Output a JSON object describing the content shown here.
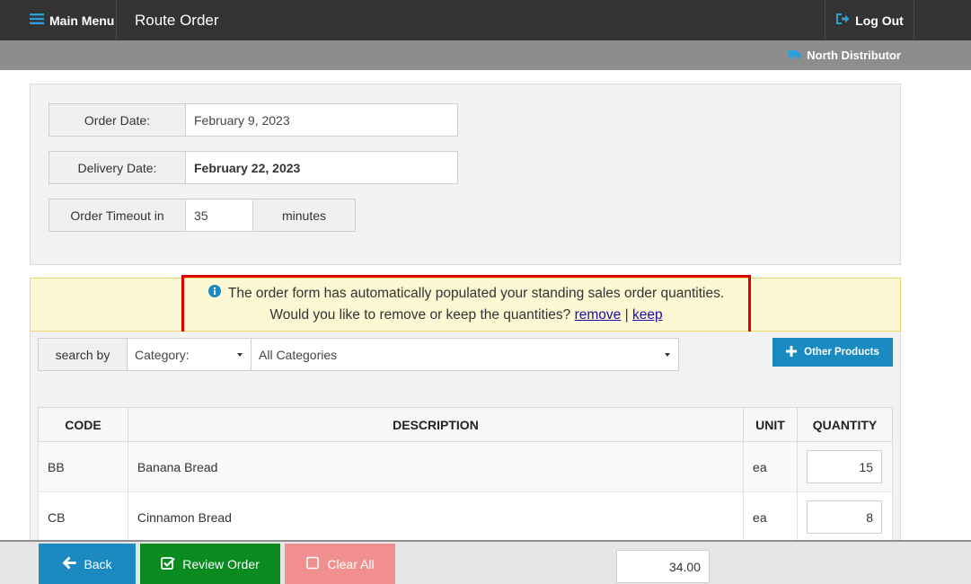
{
  "header": {
    "main_menu_label": "Main Menu",
    "title": "Route Order",
    "logout_label": "Log Out"
  },
  "subbar": {
    "distributor": "North Distributor"
  },
  "order_info": {
    "order_date_label": "Order Date:",
    "order_date_value": "February 9, 2023",
    "delivery_date_label": "Delivery Date:",
    "delivery_date_value": "February 22, 2023",
    "timeout_label": "Order Timeout in",
    "timeout_value": "35",
    "timeout_unit": "minutes"
  },
  "notice": {
    "line1": "The order form has automatically populated your standing sales order quantities.",
    "line2_prefix": "Would you like to remove or keep the quantities?",
    "remove_link": "remove",
    "separator": "|",
    "keep_link": "keep"
  },
  "search": {
    "label": "search by",
    "type_selected": "Category:",
    "category_selected": "All Categories",
    "other_products_label": "Other Products"
  },
  "table": {
    "headers": [
      "CODE",
      "DESCRIPTION",
      "UNIT",
      "QUANTITY"
    ],
    "rows": [
      {
        "code": "BB",
        "description": "Banana Bread",
        "unit": "ea",
        "quantity": "15"
      },
      {
        "code": "CB",
        "description": "Cinnamon Bread",
        "unit": "ea",
        "quantity": "8"
      }
    ]
  },
  "footer": {
    "back_label": "Back",
    "review_label": "Review Order",
    "clear_label": "Clear All",
    "total_value": "34.00"
  },
  "colors": {
    "topbar": "#333333",
    "subbar": "#8d8d8d",
    "primary_blue": "#1a8ac1",
    "review_green": "#0a8a1f",
    "clear_pink": "#f18f8f",
    "notice_bg": "#fcf8d3",
    "highlight_red": "#e00000"
  }
}
